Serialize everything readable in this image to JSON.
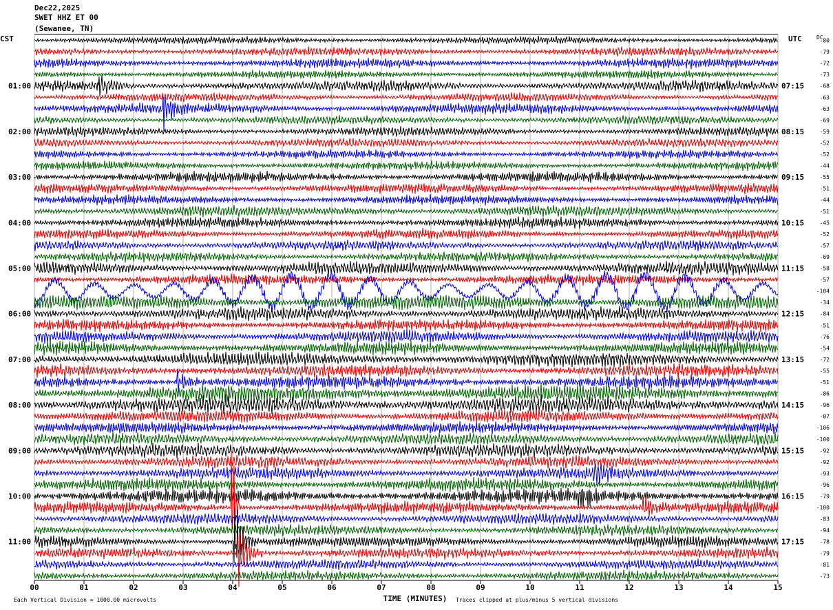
{
  "header": {
    "date": "Dec22,2025",
    "station": "SWET HHZ ET 00",
    "location": "(Sewanee, TN)"
  },
  "left_axis_title": "CST",
  "right_axis_title": "UTC",
  "dc_title": "DC",
  "footer": {
    "scale_note": "Each Vertical Division = 1000.00 microvolts",
    "xlabel": "TIME (MINUTES)",
    "clip_note": "Traces clipped at plus/minus 5 vertical divisions"
  },
  "colors": {
    "trace_cycle": [
      "#000000",
      "#e00000",
      "#0000e0",
      "#006000"
    ],
    "grid": "#b0b0b0"
  },
  "chart_data": {
    "type": "line",
    "title": "",
    "xlabel": "TIME (MINUTES)",
    "xlim": [
      0,
      15
    ],
    "x_ticks": [
      "00",
      "01",
      "02",
      "03",
      "04",
      "05",
      "06",
      "07",
      "08",
      "09",
      "10",
      "11",
      "12",
      "13",
      "14",
      "15"
    ],
    "rows": 48,
    "left_time_labels": [
      {
        "row": 4,
        "label": "01:00"
      },
      {
        "row": 8,
        "label": "02:00"
      },
      {
        "row": 12,
        "label": "03:00"
      },
      {
        "row": 16,
        "label": "04:00"
      },
      {
        "row": 20,
        "label": "05:00"
      },
      {
        "row": 24,
        "label": "06:00"
      },
      {
        "row": 28,
        "label": "07:00"
      },
      {
        "row": 32,
        "label": "08:00"
      },
      {
        "row": 36,
        "label": "09:00"
      },
      {
        "row": 40,
        "label": "10:00"
      },
      {
        "row": 44,
        "label": "11:00"
      }
    ],
    "right_time_labels": [
      {
        "row": 4,
        "label": "07:15"
      },
      {
        "row": 8,
        "label": "08:15"
      },
      {
        "row": 12,
        "label": "09:15"
      },
      {
        "row": 16,
        "label": "10:15"
      },
      {
        "row": 20,
        "label": "11:15"
      },
      {
        "row": 24,
        "label": "12:15"
      },
      {
        "row": 28,
        "label": "13:15"
      },
      {
        "row": 32,
        "label": "14:15"
      },
      {
        "row": 36,
        "label": "15:15"
      },
      {
        "row": 40,
        "label": "16:15"
      },
      {
        "row": 44,
        "label": "17:15"
      }
    ],
    "dc_offsets": [
      "-80",
      "-79",
      "-72",
      "-73",
      "-68",
      "-63",
      "-63",
      "-69",
      "-59",
      "-52",
      "-52",
      "-44",
      "-55",
      "-51",
      "-44",
      "-51",
      "-45",
      "-52",
      "-57",
      "-69",
      "-58",
      "-57",
      "-104",
      "-34",
      "-84",
      "-51",
      "-76",
      "-54",
      "-72",
      "-55",
      "-51",
      "-86",
      "-96",
      "-07",
      "-106",
      "-100",
      "-92",
      "-92",
      "-93",
      "-96",
      "-79",
      "-100",
      "-83",
      "-94",
      "-78",
      "-79",
      "-81",
      "-73"
    ],
    "trace_amplitude_divisions": [
      0.35,
      0.4,
      0.45,
      0.4,
      0.5,
      0.4,
      0.5,
      0.4,
      0.4,
      0.4,
      0.4,
      0.4,
      0.5,
      0.45,
      0.45,
      0.5,
      0.5,
      0.45,
      0.45,
      0.45,
      0.6,
      0.5,
      1.2,
      0.7,
      0.6,
      0.55,
      0.55,
      0.6,
      0.65,
      0.6,
      0.6,
      0.8,
      0.8,
      0.6,
      0.55,
      0.55,
      0.6,
      0.55,
      0.55,
      0.6,
      0.65,
      0.55,
      0.5,
      0.5,
      0.5,
      0.5,
      0.45,
      0.45
    ],
    "events": [
      {
        "row": 4,
        "minute": 1.3,
        "amplitude": 1.0,
        "duration": 0.6
      },
      {
        "row": 6,
        "minute": 2.6,
        "amplitude": 1.8,
        "duration": 0.4
      },
      {
        "row": 30,
        "minute": 2.9,
        "amplitude": 1.2,
        "duration": 0.5
      },
      {
        "row": 38,
        "minute": 11.3,
        "amplitude": 1.1,
        "duration": 0.6
      },
      {
        "row": 40,
        "minute": 11.0,
        "amplitude": 1.2,
        "duration": 0.5
      },
      {
        "row": 41,
        "minute": 12.3,
        "amplitude": 1.1,
        "duration": 0.5
      },
      {
        "row": 41,
        "minute": 4.0,
        "amplitude": 8.0,
        "duration": 0.15
      },
      {
        "row": 44,
        "minute": 4.05,
        "amplitude": 4.0,
        "duration": 0.4
      },
      {
        "row": 45,
        "minute": 4.1,
        "amplitude": 3.5,
        "duration": 0.5
      }
    ]
  }
}
